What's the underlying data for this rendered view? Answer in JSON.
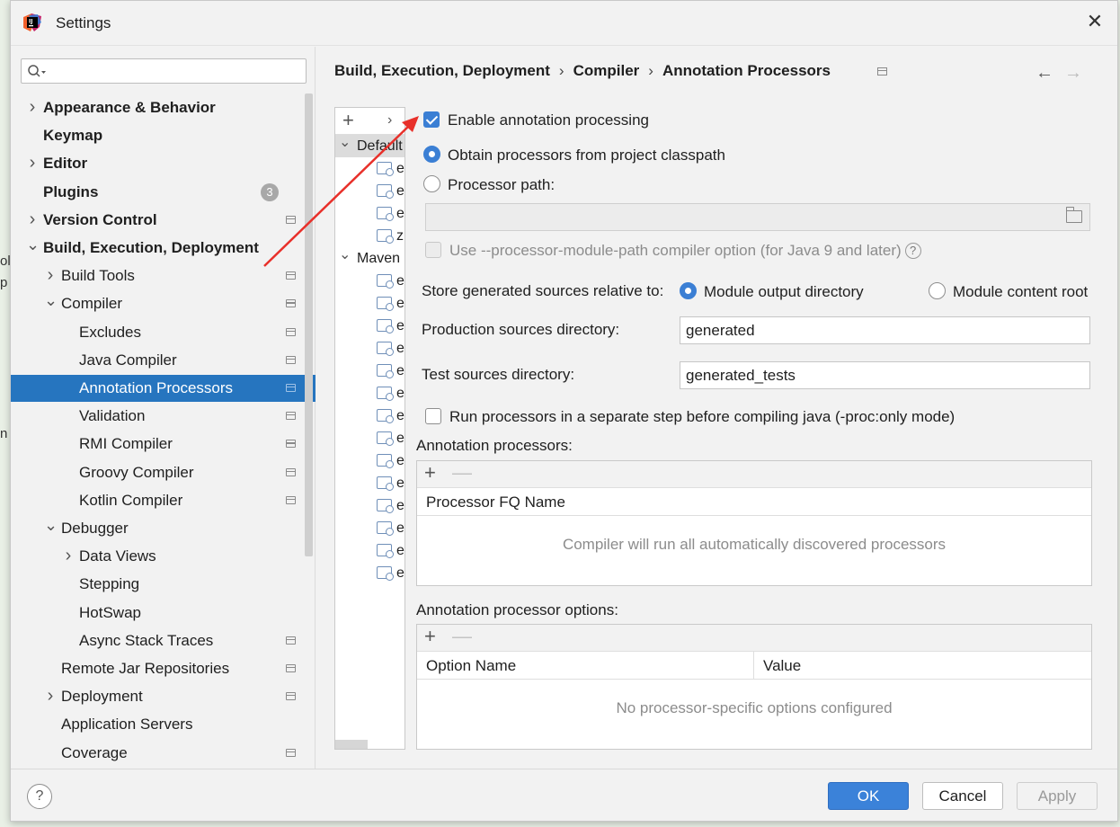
{
  "window": {
    "title": "Settings"
  },
  "sidebar": {
    "search_placeholder": "",
    "items": [
      {
        "label": "Appearance & Behavior",
        "expand": "collapsed",
        "bold": true,
        "level": 0,
        "badge": "",
        "icon": false
      },
      {
        "label": "Keymap",
        "expand": "none",
        "bold": true,
        "level": 0,
        "badge": "",
        "icon": false
      },
      {
        "label": "Editor",
        "expand": "collapsed",
        "bold": true,
        "level": 0,
        "badge": "",
        "icon": false
      },
      {
        "label": "Plugins",
        "expand": "none",
        "bold": true,
        "level": 0,
        "badge": "3",
        "icon": false
      },
      {
        "label": "Version Control",
        "expand": "collapsed",
        "bold": true,
        "level": 0,
        "badge": "",
        "icon": true
      },
      {
        "label": "Build, Execution, Deployment",
        "expand": "expanded",
        "bold": true,
        "level": 0,
        "badge": "",
        "icon": false
      },
      {
        "label": "Build Tools",
        "expand": "collapsed",
        "bold": false,
        "level": 1,
        "badge": "",
        "icon": true
      },
      {
        "label": "Compiler",
        "expand": "expanded",
        "bold": false,
        "level": 1,
        "badge": "",
        "icon": true
      },
      {
        "label": "Excludes",
        "expand": "none",
        "bold": false,
        "level": 2,
        "badge": "",
        "icon": true
      },
      {
        "label": "Java Compiler",
        "expand": "none",
        "bold": false,
        "level": 2,
        "badge": "",
        "icon": true
      },
      {
        "label": "Annotation Processors",
        "expand": "none",
        "bold": false,
        "level": 2,
        "badge": "",
        "icon": true,
        "selected": true
      },
      {
        "label": "Validation",
        "expand": "none",
        "bold": false,
        "level": 2,
        "badge": "",
        "icon": true
      },
      {
        "label": "RMI Compiler",
        "expand": "none",
        "bold": false,
        "level": 2,
        "badge": "",
        "icon": true
      },
      {
        "label": "Groovy Compiler",
        "expand": "none",
        "bold": false,
        "level": 2,
        "badge": "",
        "icon": true
      },
      {
        "label": "Kotlin Compiler",
        "expand": "none",
        "bold": false,
        "level": 2,
        "badge": "",
        "icon": true
      },
      {
        "label": "Debugger",
        "expand": "expanded",
        "bold": false,
        "level": 1,
        "badge": "",
        "icon": false
      },
      {
        "label": "Data Views",
        "expand": "collapsed",
        "bold": false,
        "level": 2,
        "badge": "",
        "icon": false
      },
      {
        "label": "Stepping",
        "expand": "none",
        "bold": false,
        "level": 2,
        "badge": "",
        "icon": false
      },
      {
        "label": "HotSwap",
        "expand": "none",
        "bold": false,
        "level": 2,
        "badge": "",
        "icon": false
      },
      {
        "label": "Async Stack Traces",
        "expand": "none",
        "bold": false,
        "level": 2,
        "badge": "",
        "icon": true
      },
      {
        "label": "Remote Jar Repositories",
        "expand": "none",
        "bold": false,
        "level": 1,
        "badge": "",
        "icon": true
      },
      {
        "label": "Deployment",
        "expand": "collapsed",
        "bold": false,
        "level": 1,
        "badge": "",
        "icon": true
      },
      {
        "label": "Application Servers",
        "expand": "none",
        "bold": false,
        "level": 1,
        "badge": "",
        "icon": false
      },
      {
        "label": "Coverage",
        "expand": "none",
        "bold": false,
        "level": 1,
        "badge": "",
        "icon": true
      }
    ]
  },
  "breadcrumb": {
    "parts": [
      "Build, Execution, Deployment",
      "Compiler",
      "Annotation Processors"
    ],
    "separator": "›"
  },
  "nav": {
    "back": "←",
    "forward": "→"
  },
  "profiles": {
    "add": "+",
    "more": "›",
    "groups": [
      {
        "label": "Default",
        "modules": [
          "e",
          "e",
          "e",
          "z"
        ]
      },
      {
        "label": "Maven",
        "modules": [
          "e",
          "e",
          "e",
          "e",
          "e",
          "e",
          "e",
          "e",
          "e",
          "e",
          "e",
          "e",
          "e",
          "e"
        ]
      }
    ]
  },
  "options": {
    "enable_label": "Enable annotation processing",
    "enable_checked": true,
    "from_classpath_label": "Obtain processors from project classpath",
    "processor_path_label": "Processor path:",
    "module_path_label": "Use --processor-module-path compiler option (for Java 9 and later)",
    "help_glyph": "?",
    "store_label": "Store generated sources relative to:",
    "module_output_label": "Module output directory",
    "module_content_label": "Module content root",
    "prod_dir_label": "Production sources directory:",
    "prod_dir_value": "generated",
    "test_dir_label": "Test sources directory:",
    "test_dir_value": "generated_tests",
    "separate_step_label": "Run processors in a separate step before compiling java (-proc:only mode)"
  },
  "processors_table": {
    "title": "Annotation processors:",
    "add": "+",
    "remove": "—",
    "column": "Processor FQ Name",
    "empty_text": "Compiler will run all automatically discovered processors"
  },
  "options_table": {
    "title": "Annotation processor options:",
    "add": "+",
    "remove": "—",
    "columns": [
      "Option Name",
      "Value"
    ],
    "empty_text": "No processor-specific options configured"
  },
  "footer": {
    "help": "?",
    "ok": "OK",
    "cancel": "Cancel",
    "apply": "Apply"
  },
  "background_fragments": [
    "ol",
    "p",
    "n"
  ],
  "colors": {
    "selection": "#2675bf",
    "accent": "#3b7fd4",
    "annotation_arrow": "#e8302a"
  }
}
